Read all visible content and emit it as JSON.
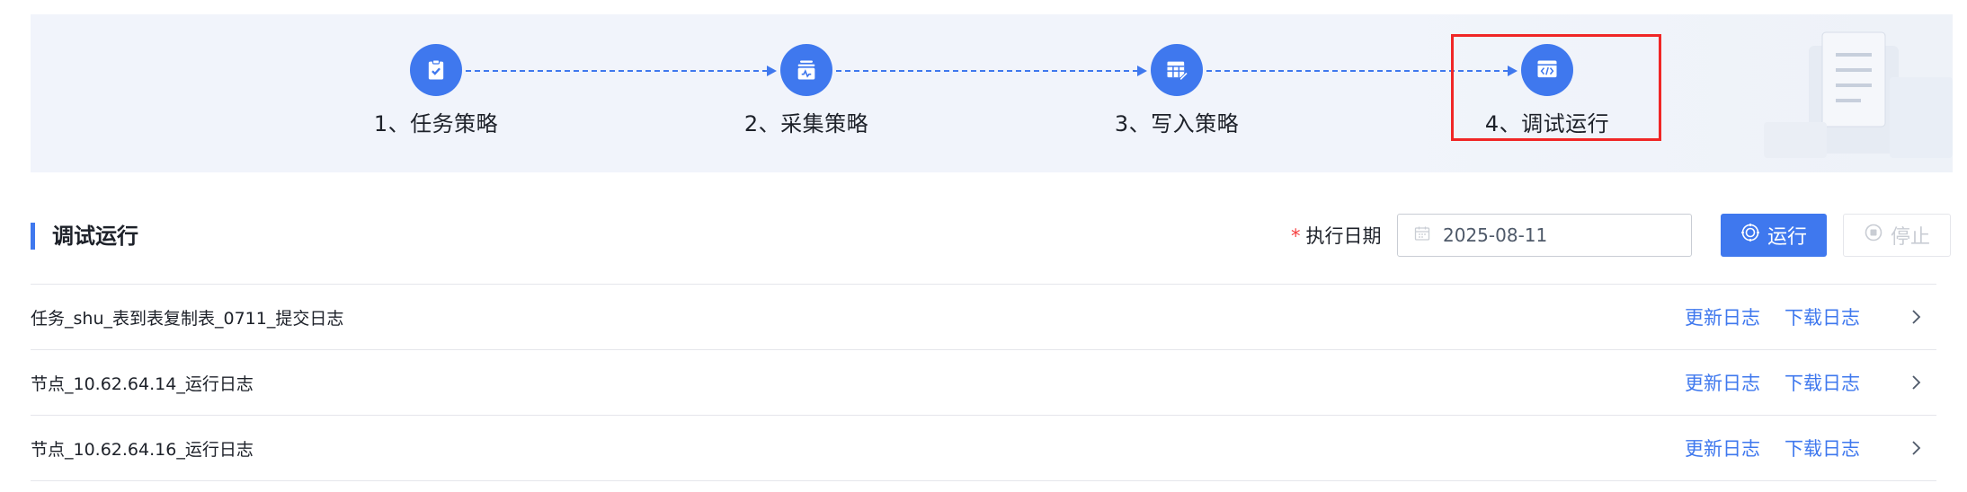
{
  "steps": [
    {
      "label": "1、任务策略",
      "icon": "clipboard-check-icon"
    },
    {
      "label": "2、采集策略",
      "icon": "collect-box-icon"
    },
    {
      "label": "3、写入策略",
      "icon": "table-edit-icon"
    },
    {
      "label": "4、调试运行",
      "icon": "debug-code-icon",
      "active": true
    }
  ],
  "section": {
    "title": "调试运行"
  },
  "exec_date": {
    "required_mark": "*",
    "label": "执行日期",
    "value": "2025-08-11",
    "icon": "calendar-icon"
  },
  "buttons": {
    "run": "运行",
    "stop": "停止"
  },
  "logs": [
    {
      "name": "任务_shu_表到表复制表_0711_提交日志",
      "refresh": "更新日志",
      "download": "下载日志"
    },
    {
      "name": "节点_10.62.64.14_运行日志",
      "refresh": "更新日志",
      "download": "下载日志"
    },
    {
      "name": "节点_10.62.64.16_运行日志",
      "refresh": "更新日志",
      "download": "下载日志"
    }
  ],
  "colors": {
    "accent": "#3f78ee",
    "highlight": "#f02626",
    "required": "#f53f3f",
    "banner_bg": "#f1f4fb"
  }
}
